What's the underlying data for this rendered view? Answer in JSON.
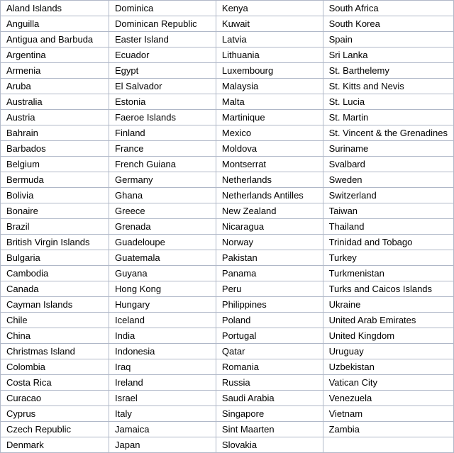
{
  "table": {
    "rows": [
      [
        "Aland Islands",
        "Dominica",
        "Kenya",
        "South Africa"
      ],
      [
        "Anguilla",
        "Dominican Republic",
        "Kuwait",
        "South Korea"
      ],
      [
        "Antigua and Barbuda",
        "Easter Island",
        "Latvia",
        "Spain"
      ],
      [
        "Argentina",
        "Ecuador",
        "Lithuania",
        "Sri Lanka"
      ],
      [
        "Armenia",
        "Egypt",
        "Luxembourg",
        "St. Barthelemy"
      ],
      [
        "Aruba",
        "El Salvador",
        "Malaysia",
        "St. Kitts and Nevis"
      ],
      [
        "Australia",
        "Estonia",
        "Malta",
        "St. Lucia"
      ],
      [
        "Austria",
        "Faeroe Islands",
        "Martinique",
        "St. Martin"
      ],
      [
        "Bahrain",
        "Finland",
        "Mexico",
        "St. Vincent & the Grenadines"
      ],
      [
        "Barbados",
        "France",
        "Moldova",
        "Suriname"
      ],
      [
        "Belgium",
        "French Guiana",
        "Montserrat",
        "Svalbard"
      ],
      [
        "Bermuda",
        "Germany",
        "Netherlands",
        "Sweden"
      ],
      [
        "Bolivia",
        "Ghana",
        "Netherlands Antilles",
        "Switzerland"
      ],
      [
        "Bonaire",
        "Greece",
        "New Zealand",
        "Taiwan"
      ],
      [
        "Brazil",
        "Grenada",
        "Nicaragua",
        "Thailand"
      ],
      [
        "British Virgin Islands",
        "Guadeloupe",
        "Norway",
        "Trinidad and Tobago"
      ],
      [
        "Bulgaria",
        "Guatemala",
        "Pakistan",
        "Turkey"
      ],
      [
        "Cambodia",
        "Guyana",
        "Panama",
        "Turkmenistan"
      ],
      [
        "Canada",
        "Hong Kong",
        "Peru",
        "Turks and Caicos Islands"
      ],
      [
        "Cayman Islands",
        "Hungary",
        "Philippines",
        "Ukraine"
      ],
      [
        "Chile",
        "Iceland",
        "Poland",
        "United Arab Emirates"
      ],
      [
        "China",
        "India",
        "Portugal",
        "United Kingdom"
      ],
      [
        "Christmas Island",
        "Indonesia",
        "Qatar",
        "Uruguay"
      ],
      [
        "Colombia",
        "Iraq",
        "Romania",
        "Uzbekistan"
      ],
      [
        "Costa Rica",
        "Ireland",
        "Russia",
        "Vatican City"
      ],
      [
        "Curacao",
        "Israel",
        "Saudi Arabia",
        "Venezuela"
      ],
      [
        "Cyprus",
        "Italy",
        "Singapore",
        "Vietnam"
      ],
      [
        "Czech Republic",
        "Jamaica",
        "Sint Maarten",
        "Zambia"
      ],
      [
        "Denmark",
        "Japan",
        "Slovakia",
        ""
      ]
    ]
  }
}
